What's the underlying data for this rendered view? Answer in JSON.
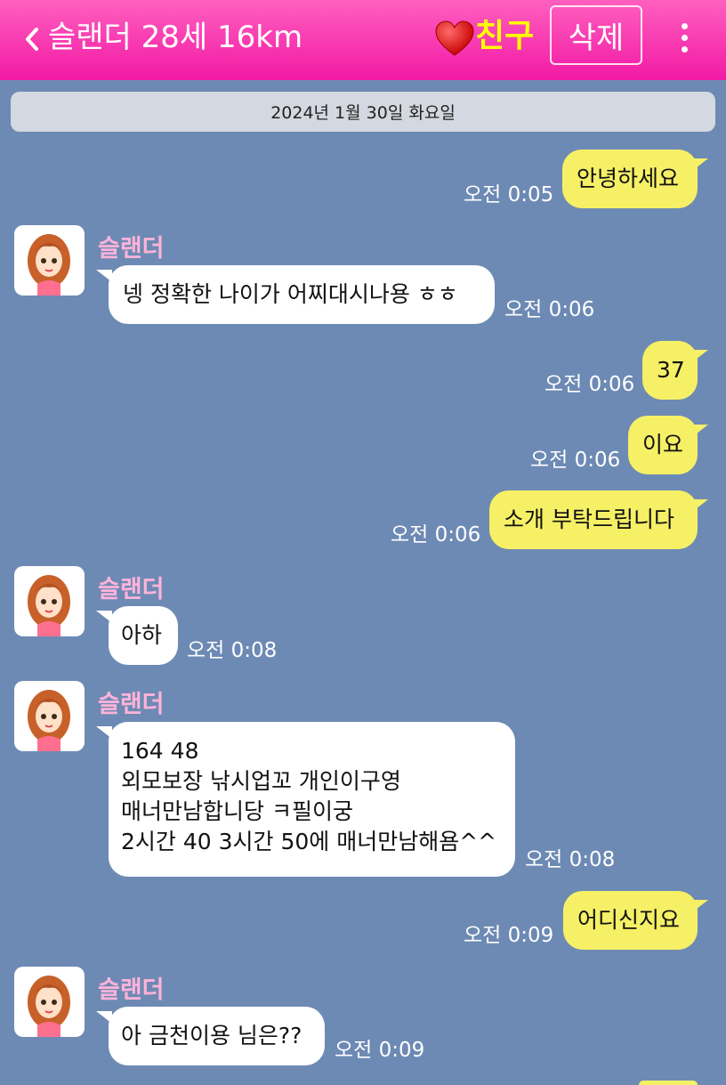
{
  "header": {
    "title": "슬랜더 28세 16km",
    "friend_label": "친구",
    "delete_label": "삭제",
    "colors": {
      "bar": "#f21aa5",
      "friend": "#ffff00"
    }
  },
  "date_divider": "2024년 1월 30일 화요일",
  "messages": [
    {
      "from": "me",
      "text": "안녕하세요",
      "time": "오전 0:05"
    },
    {
      "from": "other",
      "sender": "슬랜더",
      "text": "넹 정확한 나이가 어찌대시나용 ㅎㅎ",
      "time": "오전 0:06"
    },
    {
      "from": "me",
      "text": "37",
      "time": "오전 0:06"
    },
    {
      "from": "me",
      "text": "이요",
      "time": "오전 0:06"
    },
    {
      "from": "me",
      "text": "소개 부탁드립니다",
      "time": "오전 0:06"
    },
    {
      "from": "other",
      "sender": "슬랜더",
      "text": "아하",
      "time": "오전 0:08"
    },
    {
      "from": "other",
      "sender": "슬랜더",
      "lines": [
        "164 48",
        "외모보장 낚시업꼬 개인이구영",
        "매너만남합니당 ㅋ필이궁",
        "2시간 40 3시간 50에 매너만남해욤^^"
      ],
      "time": "오전 0:08"
    },
    {
      "from": "me",
      "text": "어디신지요",
      "time": "오전 0:09"
    },
    {
      "from": "other",
      "sender": "슬랜더",
      "text": "아 금천이용 님은??",
      "time": "오전 0:09"
    }
  ]
}
